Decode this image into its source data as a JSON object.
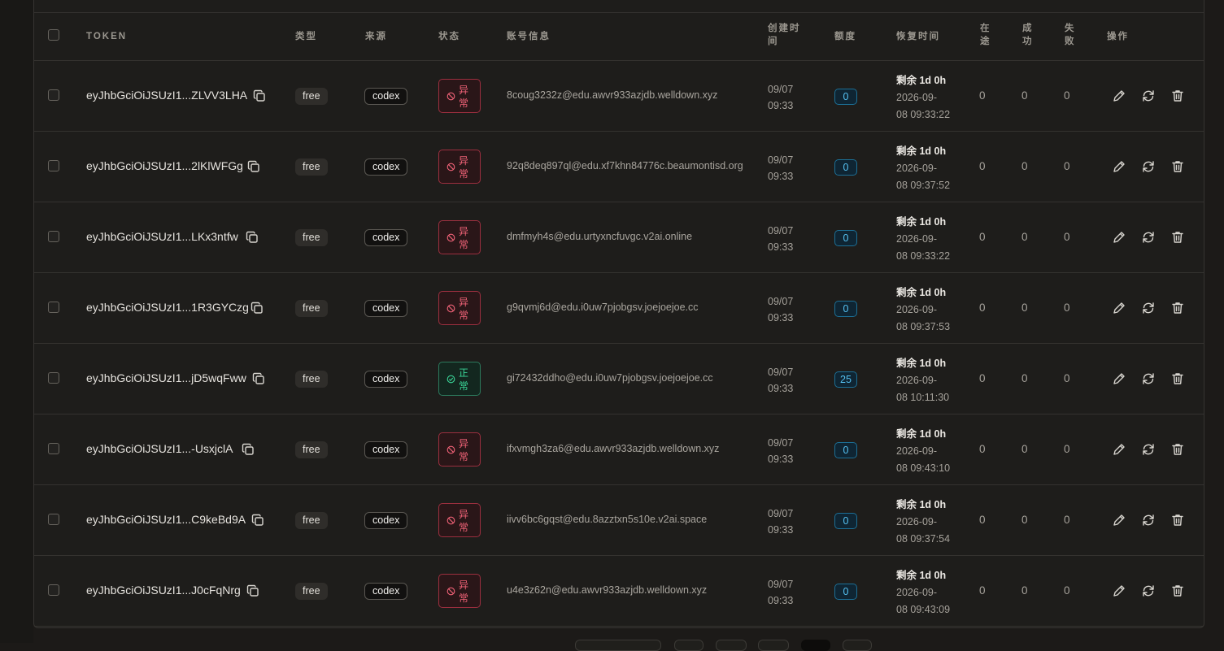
{
  "header": {
    "token": "TOKEN",
    "type": "类型",
    "source": "来源",
    "status": "状态",
    "account": "账号信息",
    "created_a": "创建时",
    "created_b": "间",
    "quota": "额度",
    "recover": "恢复时间",
    "inflight_a": "在",
    "inflight_b": "途",
    "success_a": "成",
    "success_b": "功",
    "fail_a": "失",
    "fail_b": "败",
    "actions": "操作"
  },
  "colors": {
    "error": "#f06277",
    "normal": "#3ad597",
    "quota": "#55c0f0"
  },
  "icons": {
    "copy": "copy-icon",
    "edit": "edit-icon",
    "refresh": "refresh-icon",
    "delete": "trash-icon",
    "status_error": "ban-icon",
    "status_ok": "check-circle-icon"
  },
  "rows": [
    {
      "token": "eyJhbGciOiJSUzI1...ZLVV3LHA",
      "type": "free",
      "source": "codex",
      "status": "error",
      "status_a": "异",
      "status_b": "常",
      "account": "8coug3232z@edu.awvr933azjdb.welldown.xyz",
      "created_date": "09/07",
      "created_time": "09:33",
      "quota": "0",
      "remain": "剩余 1d 0h",
      "recover_a": "2026-09-",
      "recover_b": "08 09:33:22",
      "inflight": "0",
      "success": "0",
      "fail": "0"
    },
    {
      "token": "eyJhbGciOiJSUzI1...2lKlWFGg",
      "type": "free",
      "source": "codex",
      "status": "error",
      "status_a": "异",
      "status_b": "常",
      "account": "92q8deq897ql@edu.xf7khn84776c.beaumontisd.org",
      "created_date": "09/07",
      "created_time": "09:33",
      "quota": "0",
      "remain": "剩余 1d 0h",
      "recover_a": "2026-09-",
      "recover_b": "08 09:37:52",
      "inflight": "0",
      "success": "0",
      "fail": "0"
    },
    {
      "token": "eyJhbGciOiJSUzI1...LKx3ntfw",
      "type": "free",
      "source": "codex",
      "status": "error",
      "status_a": "异",
      "status_b": "常",
      "account": "dmfmyh4s@edu.urtyxncfuvgc.v2ai.online",
      "created_date": "09/07",
      "created_time": "09:33",
      "quota": "0",
      "remain": "剩余 1d 0h",
      "recover_a": "2026-09-",
      "recover_b": "08 09:33:22",
      "inflight": "0",
      "success": "0",
      "fail": "0"
    },
    {
      "token": "eyJhbGciOiJSUzI1...1R3GYCzg",
      "type": "free",
      "source": "codex",
      "status": "error",
      "status_a": "异",
      "status_b": "常",
      "account": "g9qvmj6d@edu.i0uw7pjobgsv.joejoejoe.cc",
      "created_date": "09/07",
      "created_time": "09:33",
      "quota": "0",
      "remain": "剩余 1d 0h",
      "recover_a": "2026-09-",
      "recover_b": "08 09:37:53",
      "inflight": "0",
      "success": "0",
      "fail": "0"
    },
    {
      "token": "eyJhbGciOiJSUzI1...jD5wqFww",
      "type": "free",
      "source": "codex",
      "status": "ok",
      "status_a": "正",
      "status_b": "常",
      "account": "gi72432ddho@edu.i0uw7pjobgsv.joejoejoe.cc",
      "created_date": "09/07",
      "created_time": "09:33",
      "quota": "25",
      "remain": "剩余 1d 0h",
      "recover_a": "2026-09-",
      "recover_b": "08 10:11:30",
      "inflight": "0",
      "success": "0",
      "fail": "0"
    },
    {
      "token": "eyJhbGciOiJSUzI1...-UsxjclA",
      "type": "free",
      "source": "codex",
      "status": "error",
      "status_a": "异",
      "status_b": "常",
      "account": "ifxvmgh3za6@edu.awvr933azjdb.welldown.xyz",
      "created_date": "09/07",
      "created_time": "09:33",
      "quota": "0",
      "remain": "剩余 1d 0h",
      "recover_a": "2026-09-",
      "recover_b": "08 09:43:10",
      "inflight": "0",
      "success": "0",
      "fail": "0"
    },
    {
      "token": "eyJhbGciOiJSUzI1...C9keBd9A",
      "type": "free",
      "source": "codex",
      "status": "error",
      "status_a": "异",
      "status_b": "常",
      "account": "iivv6bc6gqst@edu.8azztxn5s10e.v2ai.space",
      "created_date": "09/07",
      "created_time": "09:33",
      "quota": "0",
      "remain": "剩余 1d 0h",
      "recover_a": "2026-09-",
      "recover_b": "08 09:37:54",
      "inflight": "0",
      "success": "0",
      "fail": "0"
    },
    {
      "token": "eyJhbGciOiJSUzI1...J0cFqNrg",
      "type": "free",
      "source": "codex",
      "status": "error",
      "status_a": "异",
      "status_b": "常",
      "account": "u4e3z62n@edu.awvr933azjdb.welldown.xyz",
      "created_date": "09/07",
      "created_time": "09:33",
      "quota": "0",
      "remain": "剩余 1d 0h",
      "recover_a": "2026-09-",
      "recover_b": "08 09:43:09",
      "inflight": "0",
      "success": "0",
      "fail": "0"
    }
  ]
}
